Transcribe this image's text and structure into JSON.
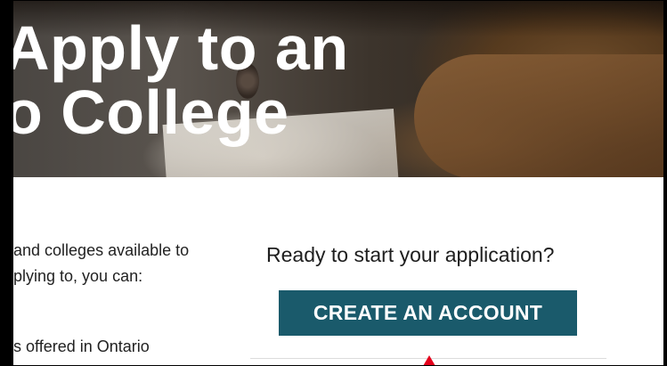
{
  "hero": {
    "title_line1": "Apply to an",
    "title_line2": "o College"
  },
  "intro": {
    "line1": "and colleges available to",
    "line2": "plying to, you can:",
    "line3": "s offered in Ontario"
  },
  "cta": {
    "prompt": "Ready to start your application?",
    "button_label": "CREATE AN ACCOUNT"
  },
  "colors": {
    "button_bg": "#1a5a6b",
    "cursor_marker": "#e4001b"
  }
}
